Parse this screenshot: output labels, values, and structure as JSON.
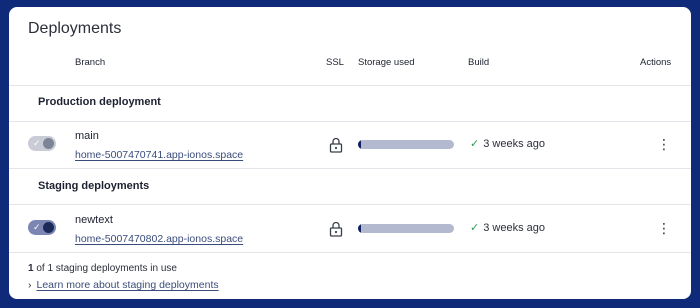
{
  "page_title": "Deployments",
  "columns": {
    "branch": "Branch",
    "ssl": "SSL",
    "storage": "Storage used",
    "build": "Build",
    "actions": "Actions"
  },
  "sections": [
    {
      "title": "Production deployment",
      "rows": [
        {
          "branch": "main",
          "url": "home-5007470741.app-ionos.space",
          "toggle_on": false,
          "storage_fraction": 0.03,
          "build_text": "3 weeks ago"
        }
      ]
    },
    {
      "title": "Staging deployments",
      "rows": [
        {
          "branch": "newtext",
          "url": "home-5007470802.app-ionos.space",
          "toggle_on": true,
          "storage_fraction": 0.03,
          "build_text": "3 weeks ago"
        }
      ]
    }
  ],
  "footer": {
    "usage_count": "1",
    "usage_text": " of 1 staging deployments in use",
    "learn_more": "Learn more about staging deployments"
  },
  "icons": {
    "toggle_check": "✓",
    "build_check": "✓",
    "kebab": "⋮",
    "chevron": "›"
  },
  "colors": {
    "background": "#0f2a78",
    "accent": "#102060",
    "success": "#2e9a54"
  }
}
